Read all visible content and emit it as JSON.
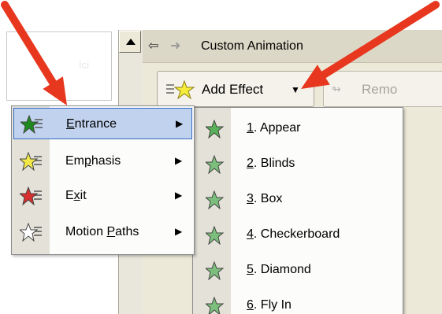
{
  "taskpane": {
    "title": "Custom Animation",
    "add_effect_label": "Add Effect",
    "remove_label": "Remo"
  },
  "thumbnail": {
    "faint_text": "Ici"
  },
  "menu": {
    "items": [
      {
        "pre": "",
        "accel": "E",
        "post": "ntrance",
        "icon": "entrance-star-icon",
        "color": "#1e8a1e",
        "highlighted": true
      },
      {
        "pre": "Em",
        "accel": "p",
        "post": "hasis",
        "icon": "emphasis-star-icon",
        "color": "#f2e84a",
        "highlighted": false
      },
      {
        "pre": "E",
        "accel": "x",
        "post": "it",
        "icon": "exit-star-icon",
        "color": "#d83030",
        "highlighted": false
      },
      {
        "pre": "Motion ",
        "accel": "P",
        "post": "aths",
        "icon": "motion-path-star-icon",
        "color": "#ffffff",
        "highlighted": false
      }
    ]
  },
  "submenu": {
    "items": [
      {
        "accel": "1",
        "rest": ". Appear"
      },
      {
        "accel": "2",
        "rest": ". Blinds"
      },
      {
        "accel": "3",
        "rest": ". Box"
      },
      {
        "accel": "4",
        "rest": ". Checkerboard"
      },
      {
        "accel": "5",
        "rest": ". Diamond"
      },
      {
        "accel": "6",
        "rest": ". Fly In"
      }
    ]
  },
  "annotation_color": "#e8371f"
}
